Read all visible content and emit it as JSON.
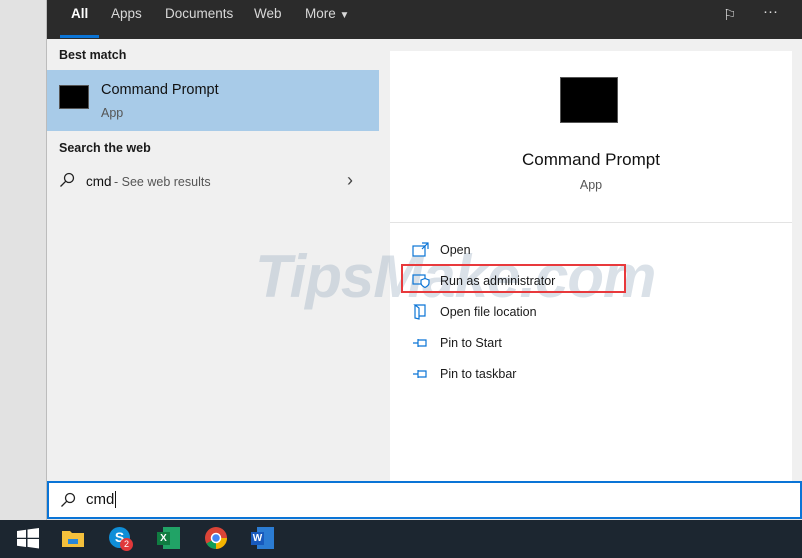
{
  "tabs": [
    {
      "label": "All"
    },
    {
      "label": "Apps"
    },
    {
      "label": "Documents"
    },
    {
      "label": "Web"
    },
    {
      "label": "More"
    }
  ],
  "left": {
    "best_match_header": "Best match",
    "best_match": {
      "title": "Command Prompt",
      "subtitle": "App"
    },
    "web_header": "Search the web",
    "web_result": {
      "query": "cmd",
      "suffix": " - See web results"
    }
  },
  "right": {
    "title": "Command Prompt",
    "subtitle": "App",
    "actions": [
      {
        "label": "Open"
      },
      {
        "label": "Run as administrator"
      },
      {
        "label": "Open file location"
      },
      {
        "label": "Pin to Start"
      },
      {
        "label": "Pin to taskbar"
      }
    ]
  },
  "search": {
    "value": "cmd"
  },
  "taskbar": {
    "skype_badge": "2",
    "excel_letter": "X",
    "word_letter": "W"
  },
  "watermark": "TipsMake.com",
  "colors": {
    "accent": "#0a74d6",
    "highlight": "#a8cbe8",
    "annotation": "#e8393c"
  }
}
